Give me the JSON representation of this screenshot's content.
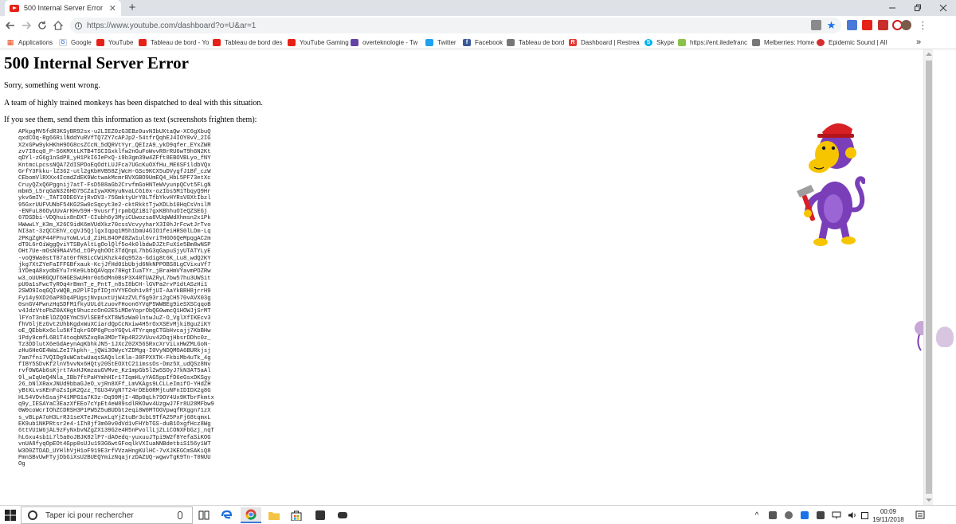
{
  "browser": {
    "tab": {
      "title": "500 Internal Server Error"
    },
    "url": "https://www.youtube.com/dashboard?o=U&ar=1",
    "bookmarks": [
      "Applications",
      "Google",
      "YouTube",
      "Tableau de bord - Yo",
      "Tableau de bord des",
      "YouTube Gaming",
      "overteknologie - Tw",
      "Twitter",
      "Facebook",
      "Tableau de bord",
      "Dashboard | Restrea",
      "Skype",
      "https://ent.iledefranc",
      "Melberries: Home",
      "Epidemic Sound | All"
    ],
    "overflow": "»"
  },
  "page": {
    "title": "500 Internal Server Error",
    "sorry": "Sorry, something went wrong.",
    "monkeys": "A team of highly trained monkeys has been dispatched to deal with this situation.",
    "send_info": "If you see them, send them this information as text (screenshots frighten them):",
    "debug_text": "APkpgMV5fdR3KSyBR92sx-u2LIEZ0zG3EBz0uvNIbUXtaQw-XC6gXbuQ\nqxdCOq-Rg66RilNddYuRVfTQ7ZY7cAPJp2-54tfrQqhEJ4IOY0vV_2IG\nX2xGPw9ykHKhH9OG8csZCcN_5dQRVtYyr_QEIzA9_ykD9qfer_EYxZWR\nzv7I8cq0_P-S6KMXtLKTB4TSCIGxklfw2nGuFoWvvR8rRU6wT9h6N2Kt\nqDYl-zG6g1nSdP8_yH1PkI6IePxQ-i9b3gm39w4ZFft8EBOVBLyo_fNY\nKntmcLpcssNQA7ZdISPDoEqOdtLUJFca7UGcKuOXfHu_ME6SF1ldbVQx\nGrfY3Fkku-lZ362-utl2gKbHVB58ZjWcH-GSc9KCX5uDVygfJ1Bf_czW\nCEbomVlRXXx4IcmdZdEK9WctwakMcmrBVXGBO9UmEQ4_HbL5PF73etXc\nCruyQZxQ6Pggnij7atT-FsD588aGb2CrvfmGoHNTeWVyunpQCvt5FLgN\nmbm5_L5rqGaN326HD75CZaIywXKHyuNvaLC610x-ozIbs5M1TbqyQ9Hr\nykv6mIV-_TATIODE6YzjRvDV3-75GmktyUrY0LTfbYkvHYRsV0XtIbzl\n95GxrUUFVUNbF54KG2Sw0cSqcyt3e2-cktRkktTjwXDLb10HqCsVnilM\n-ENFuL86OyUUvArKHv59H-9vusrfjrpmbQZiB17gxKBhhuOIeQZSEGj\n67DSDbi-VDQhuix8nDXT-CIubh6y3MyiCUwozsa8VUqWWdXhmsn2x1Pk\nHWwwLY_K3m_X26C9idK6mVUdXkz70cssVcvyyharX3I0hJrFcwtJrTvo\nNI3at-3zQCCEhV_cgVJ5QjlgxIqpq1M5h1bmU4GIO1feiHRS0lLDm-Lq\n2PKgZgKP44FPnuYoWLvLd_ZiHL84OPd8Zw1ul6vriTHGO6QeMpqgAC2m\ndT9L6rOiWggQviYTSByAltLgOolQlf5o4k0lbdwDJZtFuX1e5Bm8wNSP\nOHt7Ue-mOsN9MA4V5d_tOPyqhOOt3TdQnpL7hbG3qGapuSjyUTATYLyE\n-voQ9Wa0stT87at0rfR8icCWiKhzk4dq952a-Gdig8t6K_Lu8_wdQ2KY\njkg7XtZYeFaIFFGBfxauk-KcjJfHd01bUbjd6NkNPPOBS8LgCVixuVf7\n1YDeqA8xydbEYu7rKe9LbbQAVqqx78HgtIuaTYr_jBraHmVYavmPOZRw\nw3_oUUHRGQUT6HGESwUHnr0o5dMn0BsP3X4RTUAZRyL7bw57hu3UWSit\npU0a1sFwcTyROq4rBmnT_e_PntT_n8sI8bCH-lGVPa2rvP1dtASzHi1\n2SWO9IoqGQIvWQB_m2PlFIpfIDjnVYYEOoh1v8fjUI-AaYkBRH8jrrH9\nFy14y9XD26aP8Dq4PUgsjNvpuxtUjW4zZVLf6g93ri2gCH570vAVX03g\n0snGV4PwnzHqSDFM1fkyUULdtzuovFHoon6YVqP5WWBEg9ieSXSCqqoB\nv4JdzVtoPbZ0AXHgt9huczcOn02E5iMDeYoprObQG0wmcQ1HOWJjSrMT\nlFYoT3nbElDZQOEYmC5VlSEBfsXT8W5zWa0lntwJuZ-O_VglXfIKEcv3\nfhV6ljEzGvt2UhbKgdxWuXCiardQpCcNxiw4H5rOxXSEvMjki8gu2iKY\noE_QEbbKx6clu5KfIqkrGOP6gPcoYGQvL4TYrqmgCTGbHvcajj7KbBHw\n1Pdy9cmfL6B1T4toqbN5Zxq8a3MDrTHp4R22VUuv42DqjHbsrDDhc0z_\nTz3DDlutX6eGdAeynAqKbhkJN5-1JXcZ02X56SRxcXrViLxHWZMLGoN-\nzHu6HeGE4WaLZeI7kpkh-_jQWi3OWycYZDMgq-I0VyNDQMOA6BURkjsj\n7am7fni7VQIDg9uWCatwUaqsSAQslcKla-38FPXXTK-FkbiMb4uTk_4g\nfIBY5SDvKf2lnV5vvNx6HQty20StEOXtC21imssOs-Dmz5X_udQSz8Nv\nrvf0WGAb6sKjrt7AxHJKmzauGVMve_Kz1mpGb5l2w5SOyJ7kN3AT5aAl\n9l_wIqUeQ4Nla_IBb7ftPaHYmhHIr17IqmHLyYAG5ppIfD6eGsxDKSgy\n26_bNlXRaxJNUd9bbaGJeO_vjRn8XFf_LmVKAgs9LCLLeImifO-YHdZH\nyBtKLvsKEnFoZsIpK2Qzz_TGU34VgN7T24rDEb0RMjtuNFnIDIDX2g8G\nHL54VOvhSsajP41MPG1a7K3z-Dq99MjI-4Bp0qLh79OY4Ux9KTbrFkmtx\nq9y_IESAYaC3EazXfEEo7cYpEt4eW89sdlRKOwv4UzgwJ7Fr8U28MFbw9\n0W0coWcrIOhZCDRSH3P1PW5Z5uBUDbt2eqi8W0MTOGVpwqfRXggn71zX\ns_vBLpA7oH3LrR31seXTeJMcwxLqYjZtuBr3cbL9TfA25PxFj68tqmxL\nEK9ub1NKPRtsr2e4-1Ih8jf3m60v0dVd1vFHYbTGS-duB1OxgfHcz8Wg\n6ttVU1W6jAL9zFyNxbvNZgZX139G2e4R5nPvollLjZLiCONXFbGzj_nqT\nhL6xu4sb1L7l5a0oJBJK82lP7-dAOedq-yuxuuJTpi9W2f8YefaSiKOG\nvnUA8fyqOpEOt4Gpp0sUJu193G6wtGFoqlkVXIuaNNBdetbiS156y1WT\nW3O0ZTDAD_UYHlhVjH1oF919E3rfVVzaHngKUlHC-7vXJKEGCmSAKiQ8\nPmnSBvUwFTyjDbGiXsU2BUEQYmizNqajrzDAZUQ-wgwvTgK9Tn-T0NUU\nOg"
  },
  "taskbar": {
    "search_placeholder": "Taper ici pour rechercher",
    "time": "00:09",
    "date": "19/11/2018"
  },
  "colors": {
    "youtube_red": "#e62117",
    "monkey_purple": "#7a3fb8",
    "hat_red": "#d91f26"
  }
}
